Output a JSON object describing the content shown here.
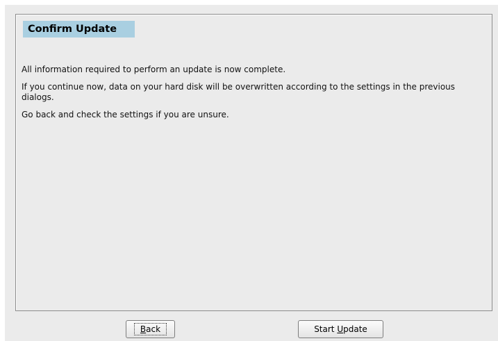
{
  "dialog": {
    "title": "Confirm Update",
    "paragraphs": [
      "All information required to perform an update is now complete.",
      "If you continue now, data on your hard disk will be overwritten according to the settings in the previous dialogs.",
      "Go back and check the settings if you are unsure."
    ]
  },
  "buttons": {
    "back": {
      "mnemonic": "B",
      "rest": "ack"
    },
    "start_update": {
      "prefix": "Start ",
      "mnemonic": "U",
      "rest": "pdate"
    }
  },
  "colors": {
    "title_background": "#a9cfe1",
    "window_background": "#ebebeb",
    "panel_border": "#8c8c8c"
  }
}
